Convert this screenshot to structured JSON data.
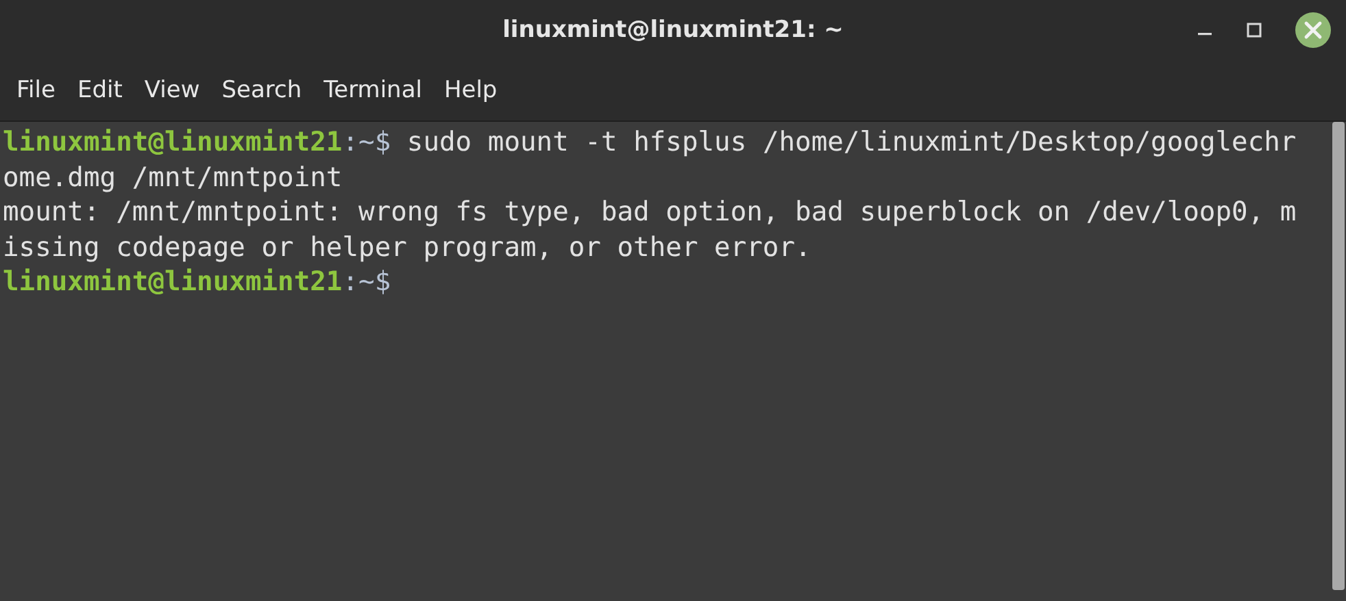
{
  "window": {
    "title": "linuxmint@linuxmint21: ~"
  },
  "menu": [
    "File",
    "Edit",
    "View",
    "Search",
    "Terminal",
    "Help"
  ],
  "terminal": {
    "lines": [
      [
        {
          "kind": "prompt_user",
          "text": "linuxmint@linuxmint21"
        },
        {
          "kind": "prompt_path",
          "text": ":~$"
        },
        {
          "kind": "command",
          "text": "sudo mount -t hfsplus /home/linuxmint/Desktop/googlechr"
        }
      ],
      [
        {
          "kind": "output",
          "text": "ome.dmg /mnt/mntpoint"
        }
      ],
      [
        {
          "kind": "output",
          "text": "mount: /mnt/mntpoint: wrong fs type, bad option, bad superblock on /dev/loop0, m"
        }
      ],
      [
        {
          "kind": "output",
          "text": "issing codepage or helper program, or other error."
        }
      ],
      [
        {
          "kind": "prompt_user",
          "text": "linuxmint@linuxmint21"
        },
        {
          "kind": "prompt_path",
          "text": ":~$"
        }
      ]
    ]
  }
}
